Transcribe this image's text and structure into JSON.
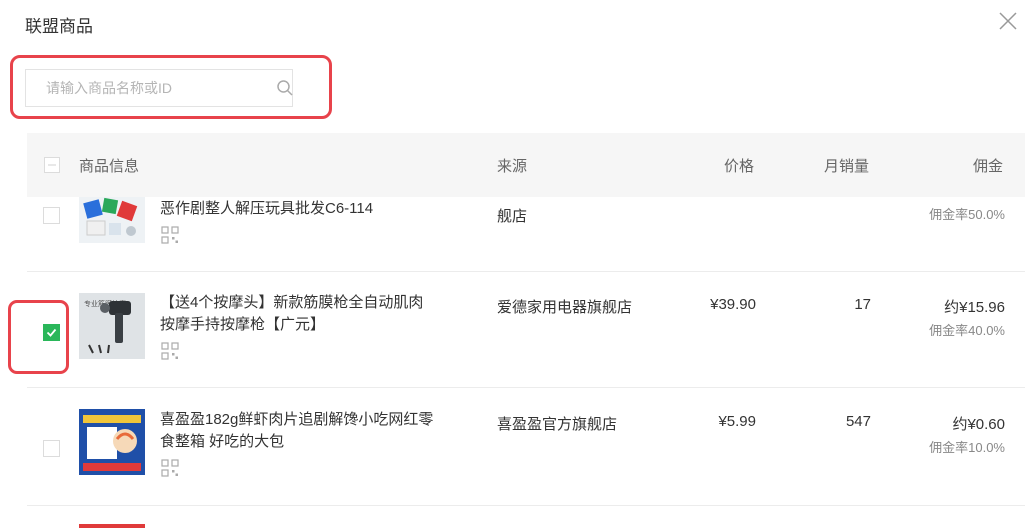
{
  "dialog": {
    "title": "联盟商品",
    "close_icon": "close-icon"
  },
  "search": {
    "placeholder": "请输入商品名称或ID",
    "value": "",
    "icon": "search-icon"
  },
  "colors": {
    "highlight": "#e8434b",
    "checkbox_checked": "#2ab75a",
    "header_bg": "#f6f6f6"
  },
  "table": {
    "headers": {
      "product": "商品信息",
      "source": "来源",
      "price": "价格",
      "sales": "月销量",
      "commission": "佣金"
    },
    "rows": [
      {
        "name": "恶作剧整人解压玩具批发C6-114",
        "source": "舰店",
        "price": "",
        "sales": "",
        "commission": "",
        "rate": "佣金率50.0%",
        "checked": false
      },
      {
        "name_line1": "【送4个按摩头】新款筋膜枪全自动肌肉",
        "name_line2": "按摩手持按摩枪【广元】",
        "source": "爱德家用电器旗舰店",
        "price": "¥39.90",
        "sales": "17",
        "commission": "约¥15.96",
        "rate": "佣金率40.0%",
        "checked": true,
        "thumb_text": "专业筋膜按摩"
      },
      {
        "name_line1": "喜盈盈182g鲜虾肉片追剧解馋小吃网红零",
        "name_line2": "食整箱 好吃的大包",
        "source": "喜盈盈官方旗舰店",
        "price": "¥5.99",
        "sales": "547",
        "commission": "约¥0.60",
        "rate": "佣金率10.0%",
        "checked": false
      }
    ]
  }
}
